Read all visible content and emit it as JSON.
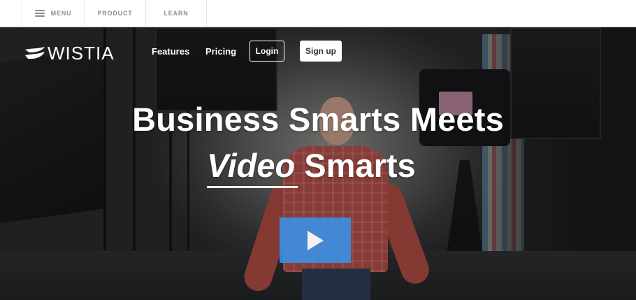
{
  "topbar": {
    "menu_label": "MENU",
    "product_label": "PRODUCT",
    "learn_label": "LEARN"
  },
  "nav": {
    "logo_text": "WISTIA",
    "features_label": "Features",
    "pricing_label": "Pricing",
    "login_label": "Login",
    "signup_label": "Sign up"
  },
  "hero": {
    "headline_line1": "Business Smarts Meets",
    "headline_emphasis": "Video",
    "headline_line2_rest": " Smarts"
  },
  "icons": {
    "menu": "hamburger-icon",
    "play": "play-icon",
    "logo": "wistia-logo-icon"
  },
  "colors": {
    "play_button": "#3d8de0",
    "topbar_text": "#8a8e93"
  }
}
